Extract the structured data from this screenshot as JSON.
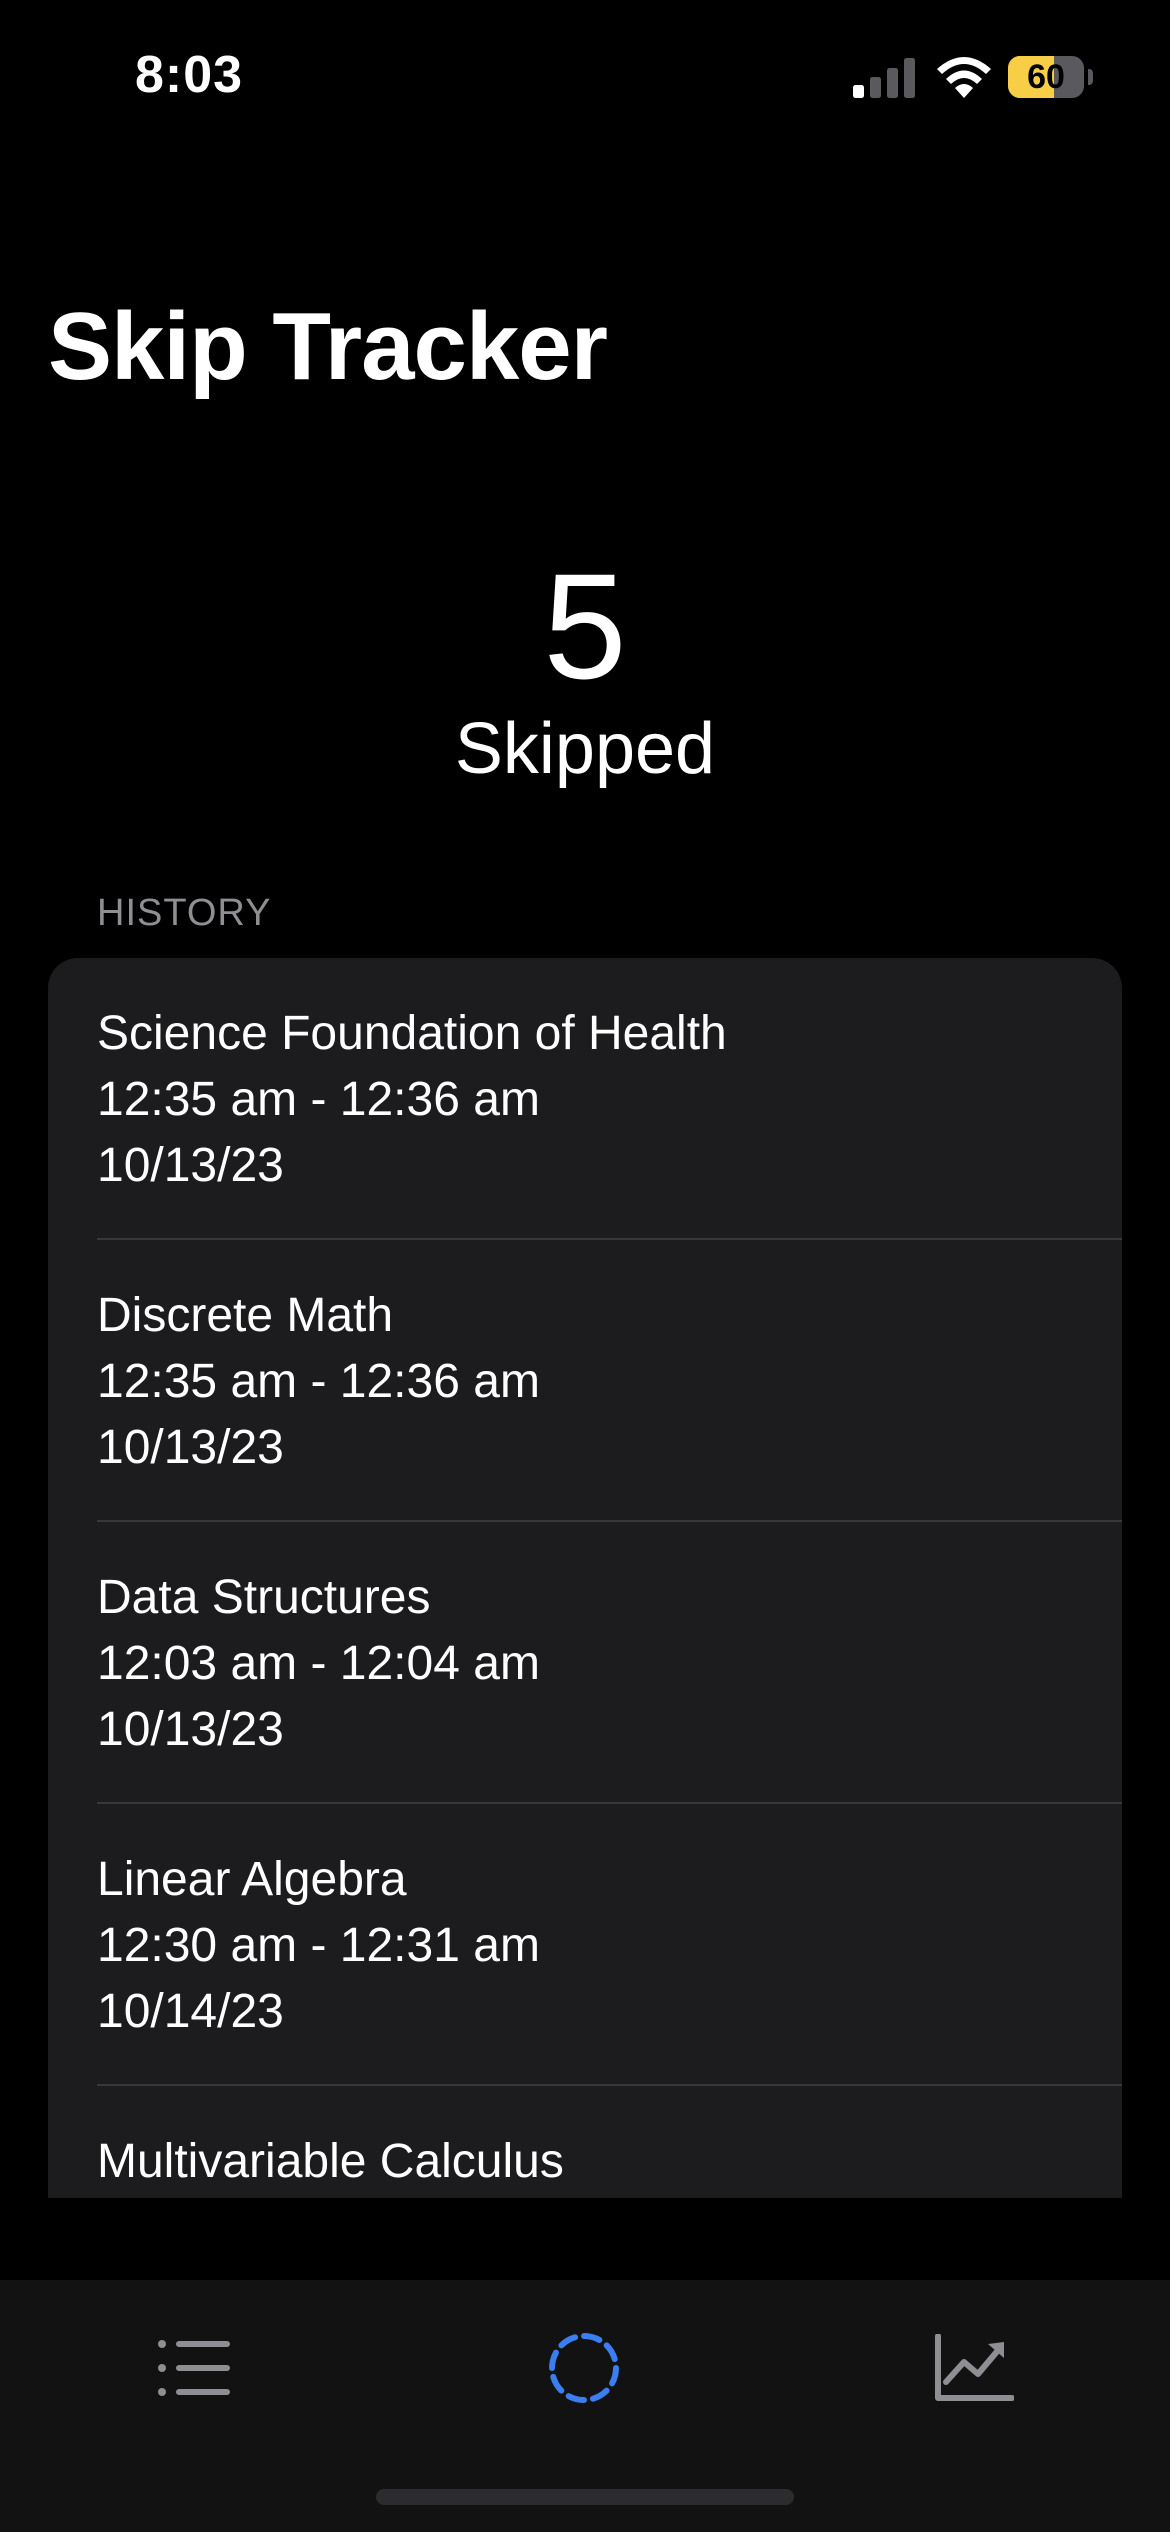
{
  "status_bar": {
    "time": "8:03",
    "battery_level": "60",
    "battery_percent": 60,
    "signal_bars_active": 1,
    "signal_bars_total": 4,
    "icons": [
      "signal-icon",
      "wifi-icon",
      "battery-icon"
    ]
  },
  "header": {
    "title": "Skip Tracker"
  },
  "counter": {
    "value": "5",
    "label": "Skipped"
  },
  "history": {
    "header": "HISTORY",
    "items": [
      {
        "name": "Science Foundation of Health",
        "time": "12:35 am - 12:36 am",
        "date": "10/13/23"
      },
      {
        "name": "Discrete Math",
        "time": "12:35 am - 12:36 am",
        "date": "10/13/23"
      },
      {
        "name": "Data Structures",
        "time": "12:03 am - 12:04 am",
        "date": "10/13/23"
      },
      {
        "name": "Linear Algebra",
        "time": "12:30 am - 12:31 am",
        "date": "10/14/23"
      },
      {
        "name": "Multivariable Calculus",
        "time": "",
        "date": ""
      }
    ]
  },
  "tab_bar": {
    "tabs": [
      {
        "icon": "list-icon",
        "selected": false
      },
      {
        "icon": "dashed-circle-icon",
        "selected": true
      },
      {
        "icon": "chart-line-icon",
        "selected": false
      }
    ]
  },
  "colors": {
    "background": "#000000",
    "card": "#1c1c1e",
    "divider": "#38383a",
    "secondary_text": "#8e8e93",
    "accent": "#3a7ef0",
    "inactive_icon": "#8e8e93",
    "battery_fill": "#f7ce45"
  }
}
